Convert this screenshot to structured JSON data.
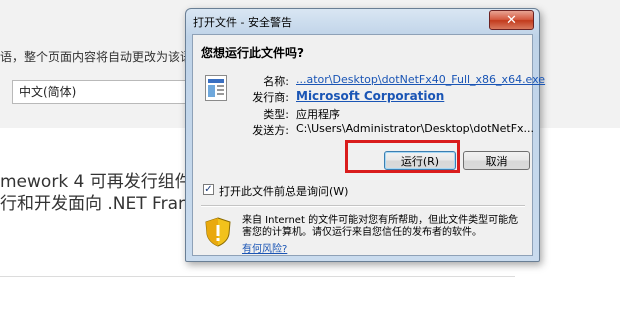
{
  "background": {
    "instruction": "语，整个页面内容将自动更改为该语言",
    "language_select_value": "中文(简体)",
    "text_line_1": "mework 4 可再发行组件",
    "text_line_2": "行和开发面向 .NET Fran"
  },
  "dialog": {
    "title": "打开文件 - 安全警告",
    "close_glyph": "✕",
    "question": "您想运行此文件吗?",
    "fields": {
      "name_label": "名称:",
      "name_value": "...ator\\Desktop\\dotNetFx40_Full_x86_x64.exe",
      "publisher_label": "发行商:",
      "publisher_value": "Microsoft Corporation",
      "type_label": "类型:",
      "type_value": "应用程序",
      "from_label": "发送方:",
      "from_value": "C:\\Users\\Administrator\\Desktop\\dotNetFx..."
    },
    "buttons": {
      "run": "运行(R)",
      "cancel": "取消"
    },
    "checkbox": {
      "label": "打开此文件前总是询问(W)",
      "checked": true
    },
    "warning": {
      "text": "来自 Internet 的文件可能对您有所帮助，但此文件类型可能危害您的计算机。请仅运行来自您信任的发布者的软件。",
      "link": "有何风险?"
    }
  },
  "colors": {
    "highlight": "#d91c1c",
    "link": "#1a55b5"
  }
}
